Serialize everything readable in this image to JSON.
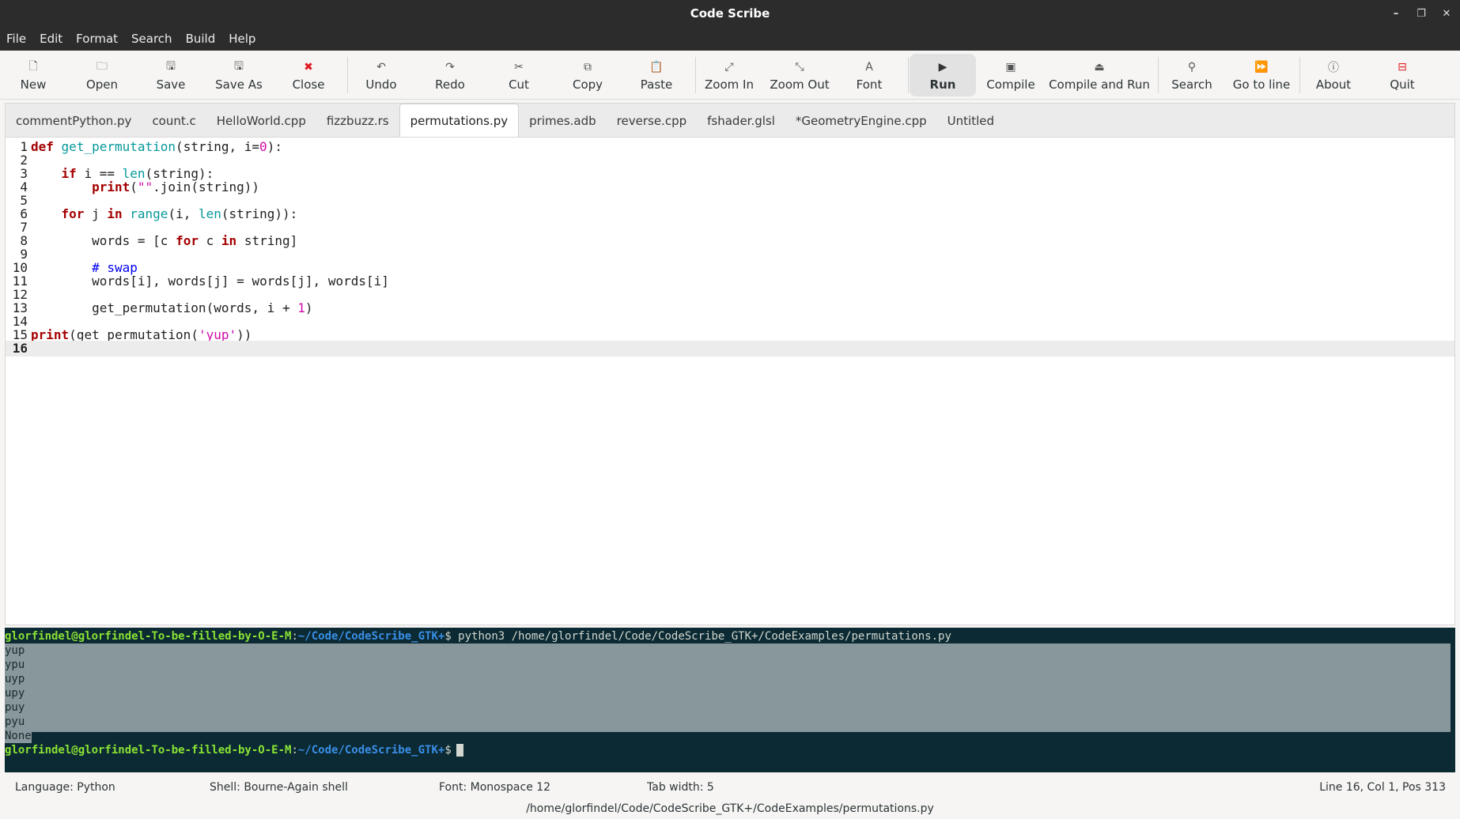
{
  "window": {
    "title": "Code Scribe",
    "controls": [
      "–",
      "❐",
      "✕"
    ]
  },
  "menu": [
    "File",
    "Edit",
    "Format",
    "Search",
    "Build",
    "Help"
  ],
  "toolbar": [
    {
      "label": "New",
      "icon": "new-file-icon",
      "glyph": "🗋"
    },
    {
      "label": "Open",
      "icon": "folder-open-icon",
      "glyph": "🗀"
    },
    {
      "label": "Save",
      "icon": "save-icon",
      "glyph": "🖫"
    },
    {
      "label": "Save As",
      "icon": "save-as-icon",
      "glyph": "🖫"
    },
    {
      "label": "Close",
      "icon": "close-icon",
      "glyph": "✖"
    },
    {
      "label": "Undo",
      "icon": "undo-icon",
      "glyph": "↶"
    },
    {
      "label": "Redo",
      "icon": "redo-icon",
      "glyph": "↷"
    },
    {
      "label": "Cut",
      "icon": "cut-icon",
      "glyph": "✂"
    },
    {
      "label": "Copy",
      "icon": "copy-icon",
      "glyph": "⧉"
    },
    {
      "label": "Paste",
      "icon": "paste-icon",
      "glyph": "📋"
    },
    {
      "label": "Zoom In",
      "icon": "zoom-in-icon",
      "glyph": "⤢"
    },
    {
      "label": "Zoom Out",
      "icon": "zoom-out-icon",
      "glyph": "⤡"
    },
    {
      "label": "Font",
      "icon": "font-icon",
      "glyph": "A"
    },
    {
      "label": "Run",
      "icon": "run-icon",
      "glyph": "▶"
    },
    {
      "label": "Compile",
      "icon": "compile-icon",
      "glyph": "▣"
    },
    {
      "label": "Compile and Run",
      "icon": "compile-and-run-icon",
      "glyph": "⏏"
    },
    {
      "label": "Search",
      "icon": "search-icon",
      "glyph": "⚲"
    },
    {
      "label": "Go to line",
      "icon": "go-to-line-icon",
      "glyph": "⏩"
    },
    {
      "label": "About",
      "icon": "about-icon",
      "glyph": "ⓘ"
    },
    {
      "label": "Quit",
      "icon": "quit-icon",
      "glyph": "⊟"
    }
  ],
  "tabs": [
    "commentPython.py",
    "count.c",
    "HelloWorld.cpp",
    "fizzbuzz.rs",
    "permutations.py",
    "primes.adb",
    "reverse.cpp",
    "fshader.glsl",
    "*GeometryEngine.cpp",
    "Untitled"
  ],
  "active_tab": "permutations.py",
  "code_lines": [
    "def get_permutation(string, i=0):",
    "",
    "    if i == len(string):",
    "        print(\"\".join(string))",
    "",
    "    for j in range(i, len(string)):",
    "",
    "        words = [c for c in string]",
    "",
    "        # swap",
    "        words[i], words[j] = words[j], words[i]",
    "",
    "        get_permutation(words, i + 1)",
    "",
    "print(get_permutation('yup'))",
    ""
  ],
  "current_line": 16,
  "terminal": {
    "prompt_user": "glorfindel@glorfindel-To-be-filled-by-O-E-M",
    "prompt_path": "~/Code/CodeScribe_GTK+",
    "command": "python3 /home/glorfindel/Code/CodeScribe_GTK+/CodeExamples/permutations.py",
    "output": [
      "yup",
      "ypu",
      "uyp",
      "upy",
      "puy",
      "pyu",
      "None"
    ]
  },
  "status": {
    "language": "Language: Python",
    "shell": "Shell: Bourne-Again shell",
    "font": "Font: Monospace 12",
    "tab_width": "Tab width: 5",
    "position": "Line 16, Col 1, Pos 313",
    "path": "/home/glorfindel/Code/CodeScribe_GTK+/CodeExamples/permutations.py"
  },
  "colors": {
    "keyword": "#a40000",
    "builtin": "#06989a",
    "literal": "#d00aa7",
    "comment": "#0000ee",
    "terminal_bg": "#0b2a33"
  }
}
